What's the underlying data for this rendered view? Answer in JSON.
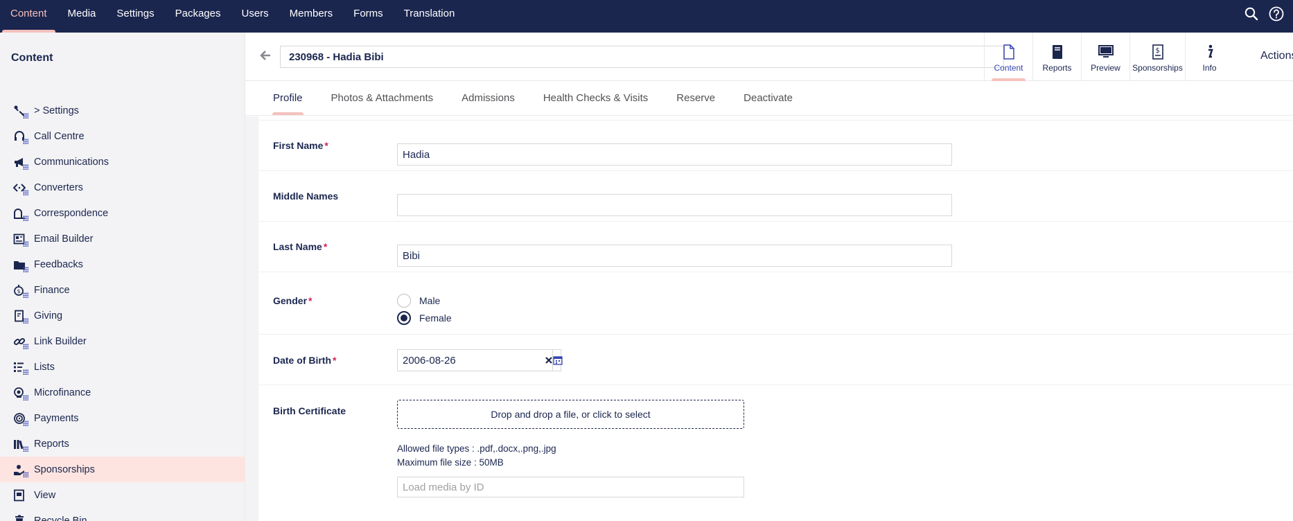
{
  "topnav": {
    "items": [
      "Content",
      "Media",
      "Settings",
      "Packages",
      "Users",
      "Members",
      "Forms",
      "Translation"
    ],
    "active_index": 0
  },
  "icons": {
    "search": "search-icon",
    "help": "help-icon"
  },
  "sidebar": {
    "title": "Content",
    "items": [
      {
        "label": "> Settings",
        "icon": "wrench-icon"
      },
      {
        "label": "Call Centre",
        "icon": "headset-icon"
      },
      {
        "label": "Communications",
        "icon": "megaphone-icon"
      },
      {
        "label": "Converters",
        "icon": "code-arrows-icon"
      },
      {
        "label": "Correspondence",
        "icon": "mailbox-icon"
      },
      {
        "label": "Email Builder",
        "icon": "newsletter-icon"
      },
      {
        "label": "Feedbacks",
        "icon": "folder-icon"
      },
      {
        "label": "Finance",
        "icon": "money-bag-icon"
      },
      {
        "label": "Giving",
        "icon": "receipt-icon"
      },
      {
        "label": "Link Builder",
        "icon": "link-icon"
      },
      {
        "label": "Lists",
        "icon": "list-icon"
      },
      {
        "label": "Microfinance",
        "icon": "coins-icon"
      },
      {
        "label": "Payments",
        "icon": "payment-icon"
      },
      {
        "label": "Reports",
        "icon": "books-icon"
      },
      {
        "label": "Sponsorships",
        "icon": "hand-heart-icon"
      },
      {
        "label": "View",
        "icon": "document-view-icon"
      },
      {
        "label": "Recycle Bin",
        "icon": "trash-icon"
      }
    ],
    "active_index": 14
  },
  "header": {
    "name_value": "230968 - Hadia Bibi",
    "apps": [
      {
        "label": "Content",
        "icon": "document-icon"
      },
      {
        "label": "Reports",
        "icon": "book-icon"
      },
      {
        "label": "Preview",
        "icon": "monitor-icon"
      },
      {
        "label": "Sponsorships",
        "icon": "certificate-icon"
      },
      {
        "label": "Info",
        "icon": "info-icon"
      }
    ],
    "active_app_index": 0,
    "actions_label": "Actions"
  },
  "tabs": {
    "items": [
      "Profile",
      "Photos & Attachments",
      "Admissions",
      "Health Checks & Visits",
      "Reserve",
      "Deactivate"
    ],
    "active_index": 0
  },
  "form": {
    "first_name": {
      "label": "First Name",
      "value": "Hadia",
      "required": "*"
    },
    "middle_names": {
      "label": "Middle Names",
      "value": ""
    },
    "last_name": {
      "label": "Last Name",
      "value": "Bibi",
      "required": "*"
    },
    "gender": {
      "label": "Gender",
      "required": "*",
      "options": [
        "Male",
        "Female"
      ],
      "selected": "Female"
    },
    "dob": {
      "label": "Date of Birth",
      "required": "*",
      "value": "2006-08-26"
    },
    "birth_certificate": {
      "label": "Birth Certificate",
      "dropzone": "Drop and drop a file, or click to select",
      "allowed": "Allowed file types : .pdf,.docx,.png,.jpg",
      "max_size": "Maximum file size : 50MB",
      "media_placeholder": "Load media by ID"
    }
  },
  "colors": {
    "topbar": "#1b264f",
    "active_accent": "#f5c1bc",
    "sidebar_bg": "#f3f3f5",
    "sidebar_active_bg": "#fde4e0",
    "required": "#d42054"
  }
}
